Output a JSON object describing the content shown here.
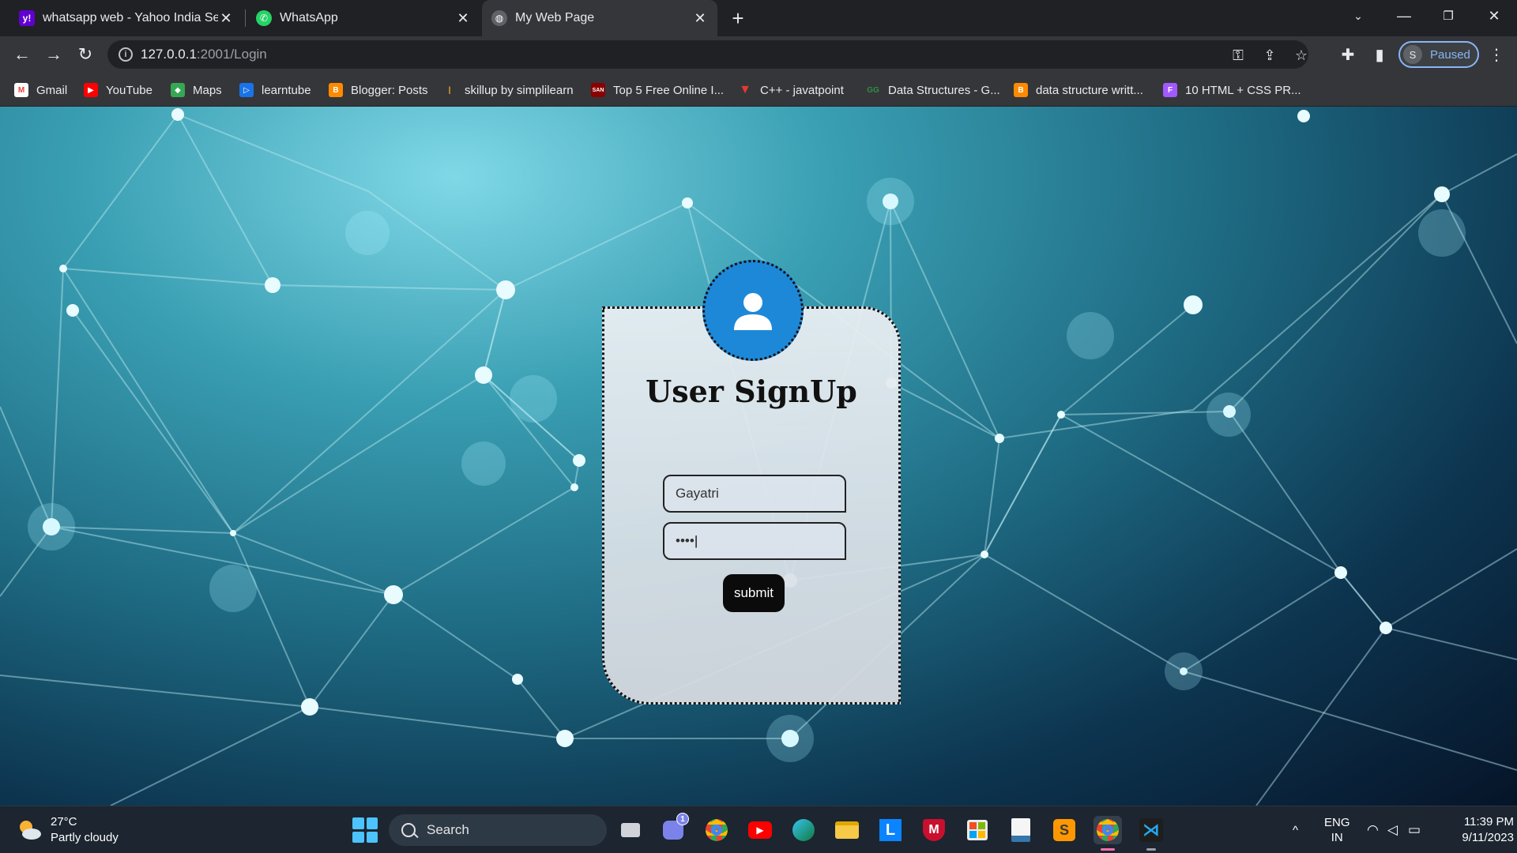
{
  "tabs": [
    {
      "title": "whatsapp web - Yahoo India Sear",
      "icon": "yahoo-icon",
      "color": "#6001d2"
    },
    {
      "title": "WhatsApp",
      "icon": "whatsapp-icon",
      "color": "#25d366"
    },
    {
      "title": "My Web Page",
      "icon": "globe-icon",
      "color": "#9aa0a6",
      "active": true
    }
  ],
  "address_bar": {
    "host": "127.0.0.1",
    "rest": ":2001/Login"
  },
  "profile": {
    "initial": "S",
    "label": "Paused"
  },
  "bookmarks": [
    {
      "label": "Gmail",
      "icon": "gmail-icon"
    },
    {
      "label": "YouTube",
      "icon": "youtube-icon"
    },
    {
      "label": "Maps",
      "icon": "maps-icon"
    },
    {
      "label": "learntube",
      "icon": "learntube-icon"
    },
    {
      "label": "Blogger: Posts",
      "icon": "blogger-icon"
    },
    {
      "label": "skillup by simplilearn",
      "icon": "skillup-icon"
    },
    {
      "label": "Top 5 Free Online I...",
      "icon": "san-icon"
    },
    {
      "label": "C++ - javatpoint",
      "icon": "javatpoint-icon"
    },
    {
      "label": "Data Structures - G...",
      "icon": "gfg-icon"
    },
    {
      "label": "data structure writt...",
      "icon": "blogger-icon"
    },
    {
      "label": "10 HTML + CSS PR...",
      "icon": "figma-icon"
    }
  ],
  "form": {
    "title": "User SignUp",
    "username_value": "Gayatri",
    "password_value": "••••",
    "submit_label": "submit"
  },
  "taskbar": {
    "weather_temp": "27°C",
    "weather_desc": "Partly cloudy",
    "search_label": "Search",
    "lang_top": "ENG",
    "lang_bottom": "IN",
    "time": "11:39 PM",
    "date": "9/11/2023",
    "chat_badge": "1"
  },
  "colors": {
    "avatar_blue": "#1e88d8",
    "button_black": "#0b0b0b",
    "accent": "#8ab4f8"
  }
}
